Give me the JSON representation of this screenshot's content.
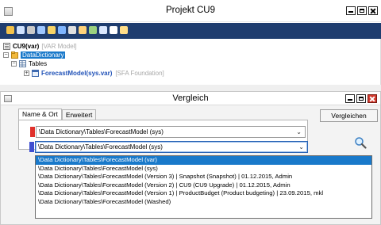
{
  "window": {
    "title": "Projekt CU9"
  },
  "toolbar": {
    "icons": [
      "open-icon",
      "save-icon",
      "edit-icon",
      "rename-icon",
      "filter-icon",
      "bars-icon",
      "copy-icon",
      "paste-icon",
      "chart-icon",
      "undo-icon",
      "compare-icon",
      "export-icon"
    ],
    "colors": [
      "#f3c24a",
      "#cfe2ff",
      "#c9c9c9",
      "#9ec7ff",
      "#f8d466",
      "#7fb5ff",
      "#e0e0e0",
      "#ffd27a",
      "#9bd17f",
      "#dbe8ff",
      "#ffffff",
      "#ffdd88"
    ]
  },
  "tree": {
    "root_label": "CU9(var)",
    "root_tag": "[VAR Model]",
    "data_dictionary": "DataDictionary",
    "tables": "Tables",
    "forecast_model": "ForecastModel(sys.var)",
    "forecast_tag": "[SFA Foundation]"
  },
  "dialog": {
    "title": "Vergleich",
    "tabs": [
      "Name & Ort",
      "Erweitert"
    ],
    "combo1_value": "\\Data Dictionary\\Tables\\ForecastModel (sys)",
    "combo2_value": "\\Data Dictionary\\Tables\\ForecastModel (sys)",
    "compare_button": "Vergleichen",
    "combo1_color": "#e0312b",
    "combo2_color": "#3f4fd0",
    "dropdown_items": [
      "\\Data Dictionary\\Tables\\ForecastModel (var)",
      "\\Data Dictionary\\Tables\\ForecastModel (sys)",
      "\\Data Dictionary\\Tables\\ForecastModel (Version 3) | Snapshot (Snapshot) | 01.12.2015, Admin",
      "\\Data Dictionary\\Tables\\ForecastModel (Version 2) | CU9 (CU9 Upgrade) | 01.12.2015, Admin",
      "\\Data Dictionary\\Tables\\ForecastModel (Version 1) | ProductBudget (Product budgeting) | 23.09.2015, mkl",
      "\\Data Dictionary\\Tables\\ForecastModel (Washed)"
    ]
  }
}
